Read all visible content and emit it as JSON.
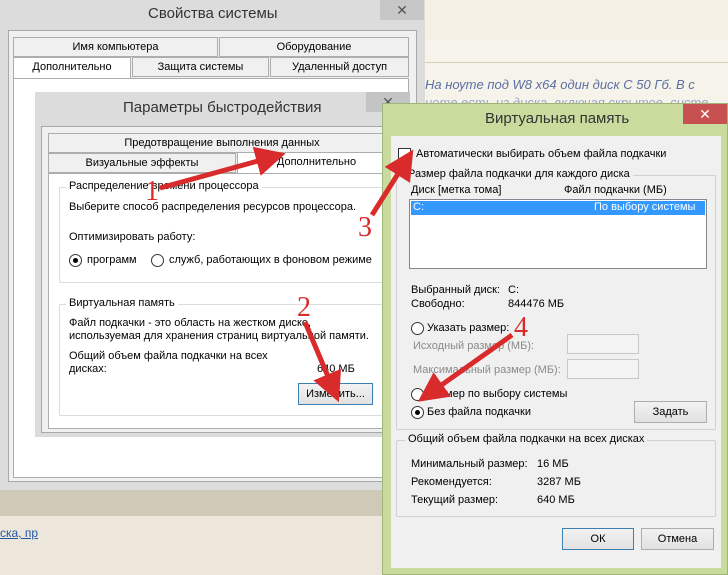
{
  "background_page": {
    "post_line1": "На ноуте под W8 x64 один диск C 50 Гб. В с",
    "post_line2": "ноте есть из диска, включая скрытое, систе",
    "links": "ска, пр"
  },
  "system_properties": {
    "title": "Свойства системы",
    "tabs_row1": [
      "Имя компьютера",
      "Оборудование"
    ],
    "tabs_row2": [
      "Дополнительно",
      "Защита системы",
      "Удаленный доступ"
    ]
  },
  "performance_options": {
    "title": "Параметры быстродействия",
    "tabs_row1": [
      "Предотвращение выполнения данных"
    ],
    "tabs_row2": [
      "Визуальные эффекты",
      "Дополнительно"
    ],
    "cpu_group": {
      "legend": "Распределение времени процессора",
      "description": "Выберите способ распределения ресурсов процессора.",
      "optimize_label": "Оптимизировать работу:",
      "option_programs": "программ",
      "option_services": "служб, работающих в фоновом режиме"
    },
    "vm_group": {
      "legend": "Виртуальная память",
      "desc1": "Файл подкачки - это область на жестком диске,",
      "desc2": "используемая для хранения страниц виртуальной памяти.",
      "total1": "Общий объем файла подкачки на всех",
      "total2": "дисках:",
      "total_value": "640 МБ",
      "change_button": "Изменить..."
    }
  },
  "virtual_memory": {
    "title": "Виртуальная память",
    "auto_checkbox": "Автоматически выбирать объем файла подкачки",
    "per_drive_legend": "Размер файла подкачки для каждого диска",
    "col_drive": "Диск [метка тома]",
    "col_paging": "Файл подкачки (МБ)",
    "drive_row": {
      "drive": "C:",
      "size": "По выбору системы"
    },
    "selected_drive_label": "Выбранный диск:",
    "selected_drive_value": "C:",
    "free_label": "Свободно:",
    "free_value": "844476 МБ",
    "custom_size": "Указать размер:",
    "initial_size": "Исходный размер (МБ):",
    "max_size": "Максимальный размер (МБ):",
    "system_managed": "Размер по выбору системы",
    "no_paging": "Без файла подкачки",
    "set_button": "Задать",
    "total_legend": "Общий объем файла подкачки на всех дисках",
    "min_label": "Минимальный размер:",
    "min_value": "16 МБ",
    "recommended_label": "Рекомендуется:",
    "recommended_value": "3287 МБ",
    "current_label": "Текущий размер:",
    "current_value": "640 МБ",
    "ok_button": "ОК",
    "cancel_button": "Отмена"
  },
  "annotations": [
    "1",
    "2",
    "3",
    "4"
  ],
  "accent_colors": {
    "arrow": "#d92b2b",
    "selection": "#3399ff",
    "vm_frame": "#c9dc9e"
  }
}
